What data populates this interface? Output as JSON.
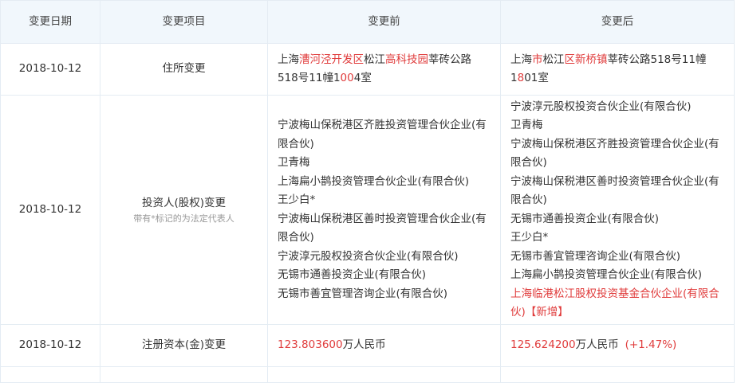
{
  "headers": [
    "变更日期",
    "变更项目",
    "变更前",
    "变更后"
  ],
  "rows": [
    {
      "date": "2018-10-12",
      "item": "住所变更",
      "before": [
        {
          "t": "上海",
          "r": false
        },
        {
          "t": "漕河泾开发区",
          "r": true
        },
        {
          "t": "松江",
          "r": false
        },
        {
          "t": "高科技园",
          "r": true
        },
        {
          "t": "莘砖公路518号11幢1",
          "r": false
        },
        {
          "t": "00",
          "r": true
        },
        {
          "t": "4",
          "r": false
        },
        {
          "t": "室",
          "r": false
        }
      ],
      "after": [
        {
          "t": "上海",
          "r": false
        },
        {
          "t": "市",
          "r": true
        },
        {
          "t": "松江",
          "r": false
        },
        {
          "t": "区新桥镇",
          "r": true
        },
        {
          "t": "莘砖公路518号11幢1",
          "r": false
        },
        {
          "t": "8",
          "r": true
        },
        {
          "t": "01室",
          "r": false
        }
      ]
    },
    {
      "date": "2018-10-12",
      "item": "投资人(股权)变更",
      "item_note": "带有*标记的为法定代表人",
      "before_lines": [
        "宁波梅山保税港区齐胜投资管理合伙企业(有限合伙)",
        "卫青梅",
        "上海扁小鹊投资管理合伙企业(有限合伙)",
        "王少白*",
        "宁波梅山保税港区善时投资管理合伙企业(有限合伙)",
        "宁波淳元股权投资合伙企业(有限合伙)",
        "无锡市通善投资企业(有限合伙)",
        "无锡市善宜管理咨询企业(有限合伙)"
      ],
      "after_lines": [
        "宁波淳元股权投资合伙企业(有限合伙)",
        "卫青梅",
        "宁波梅山保税港区齐胜投资管理合伙企业(有限合伙)",
        "宁波梅山保税港区善时投资管理合伙企业(有限合伙)",
        "无锡市通善投资企业(有限合伙)",
        "王少白*",
        "无锡市善宜管理咨询企业(有限合伙)",
        "上海扁小鹊投资管理合伙企业(有限合伙)"
      ],
      "after_new": "上海临港松江股权投资基金合伙企业(有限合伙)【新增】"
    },
    {
      "date": "2018-10-12",
      "item": "注册资本(金)变更",
      "before_value": "123.803600",
      "before_unit": "万人民币",
      "after_value": "125.624200",
      "after_unit": "万人民币",
      "after_change": "(+1.47%)"
    }
  ],
  "colors": {
    "header_bg": "#f1f7fc",
    "border": "#e4ecf3",
    "highlight": "#e03c3c"
  }
}
